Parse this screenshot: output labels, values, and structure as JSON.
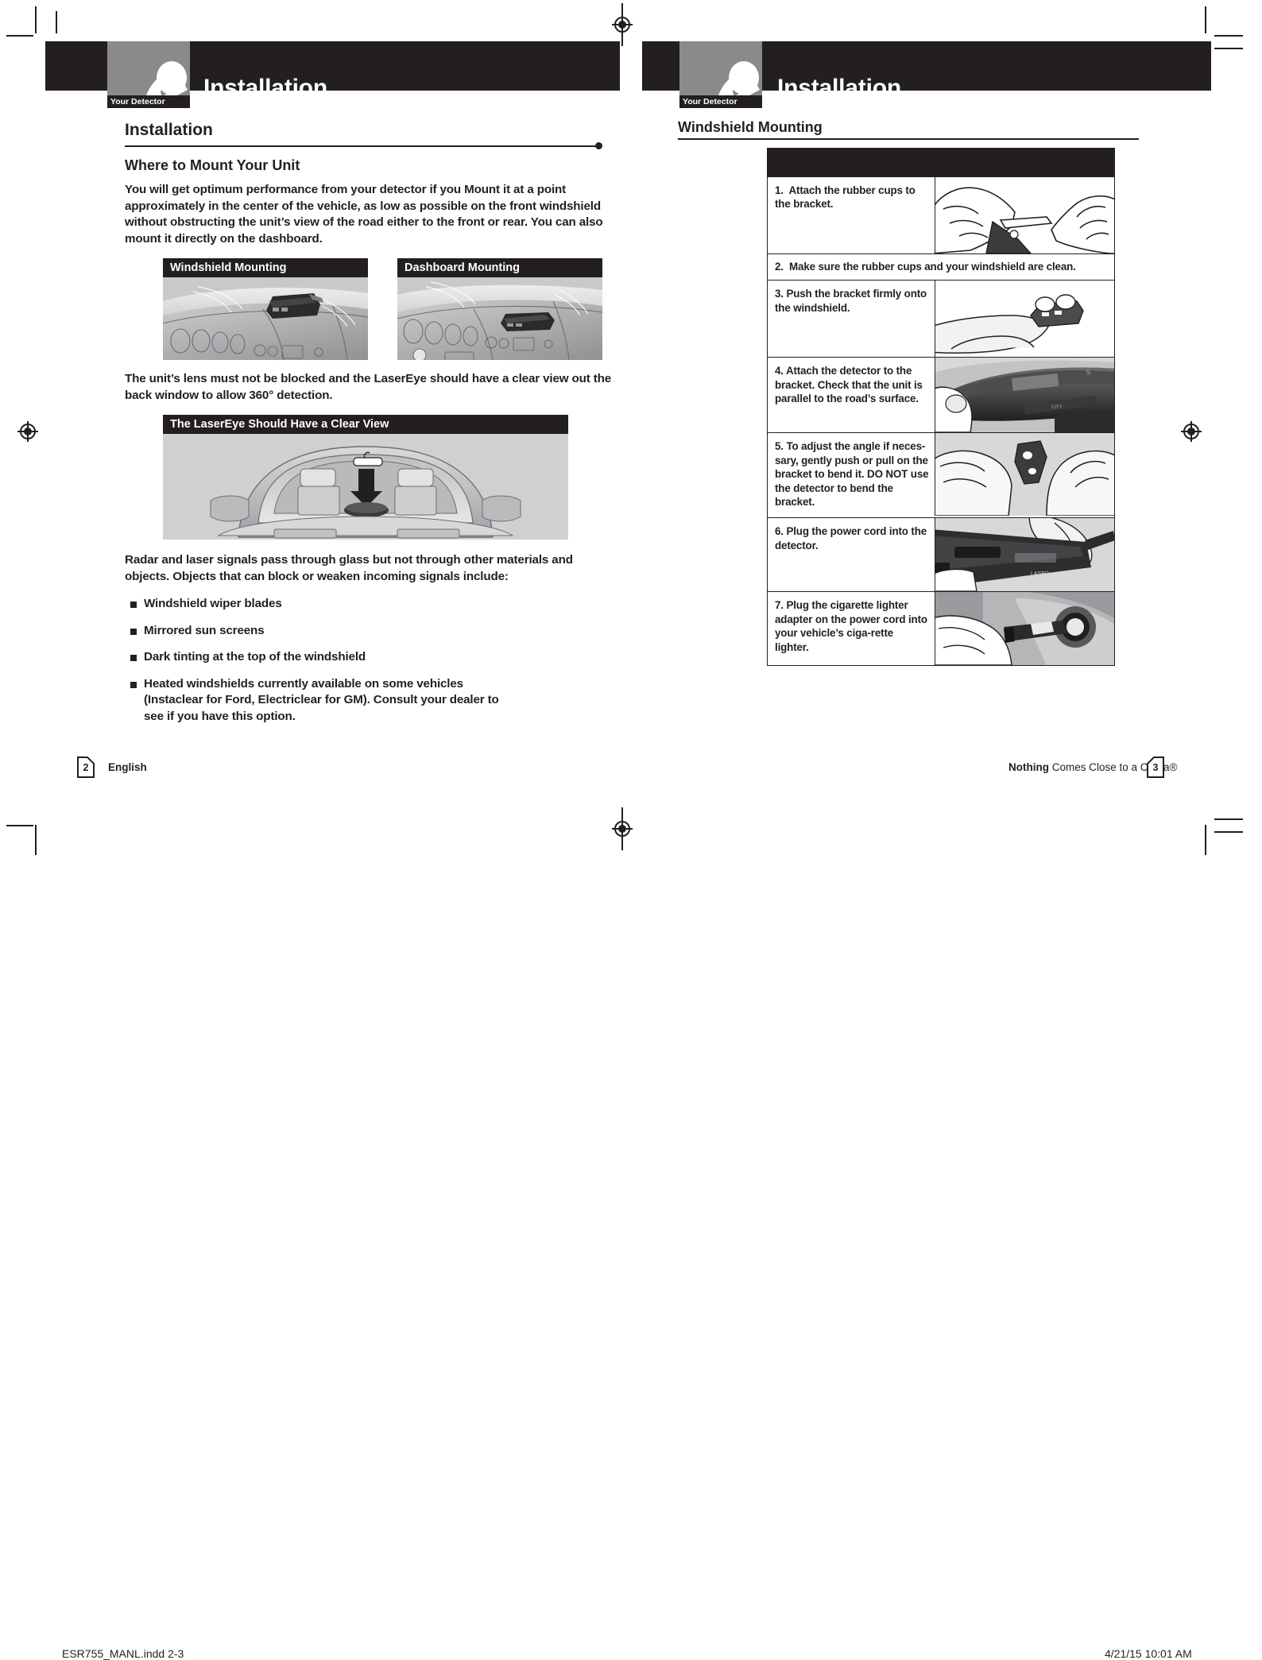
{
  "spread": {
    "left_page": {
      "banner": {
        "title": "Installation",
        "tab_label": "Your Detector",
        "tab_icon": "detector-icon"
      },
      "section_title": "Installation",
      "subsection_title": "Where to Mount Your Unit",
      "intro_paragraph_1": "You will get optimum performance from your detector if you ",
      "intro_bold": "Mount",
      "intro_paragraph_2": " it at a point approximately in the center of the vehicle, as low as possible on the front windshield without obstructing the unit’s view of the road either to the front or rear. You can also mount it directly on the dashboard.",
      "figure_row": [
        {
          "caption": "Windshield Mounting",
          "image": "windshield-mounting-illustration"
        },
        {
          "caption": "Dashboard Mounting",
          "image": "dashboard-mounting-illustration"
        }
      ],
      "paragraph_lens": "The unit’s lens must not be blocked and the LaserEye should have a clear view out the back window to allow 360° detection.",
      "figure_wide": {
        "caption": "The LaserEye Should Have a Clear View",
        "image": "rear-view-clear-view-illustration"
      },
      "paragraph_signals": "Radar and laser signals pass through glass but not through other materials and objects. Objects that can block or weaken incoming signals include:",
      "bullets": [
        "Windshield wiper blades",
        "Mirrored sun screens",
        "Dark tinting at the top of the windshield",
        "Heated windshields currently available on some vehicles (Instaclear for Ford, Electriclear for GM). Consult your dealer to see if you have this option."
      ],
      "footer": {
        "page_number": "2",
        "label": "English"
      }
    },
    "right_page": {
      "banner": {
        "title": "Installation",
        "tab_label": "Your Detector",
        "tab_icon": "detector-icon"
      },
      "section_title": "Windshield Mounting",
      "steps": [
        {
          "number": "1.",
          "text": "Attach the rubber cups to the bracket.",
          "bold_tail": "",
          "image": "attach-rubber-cups-illustration",
          "full_width": false
        },
        {
          "number": "2.",
          "text": "Make sure the rubber cups and your windshield are clean.",
          "bold_tail": "",
          "image": "",
          "full_width": true
        },
        {
          "number": "3.",
          "text": "Push the bracket firmly onto the windshield.",
          "bold_tail": "",
          "image": "push-bracket-illustration",
          "full_width": false
        },
        {
          "number": "4.",
          "text": "Attach the detector to ",
          "bold_tail": "the bracket. Check that the unit is parallel to the road’s surface.",
          "image": "attach-detector-illustration",
          "full_width": false
        },
        {
          "number": "5.",
          "text": "To adjust the angle if neces-sary, gently push or pull on the bracket to bend it. DO NOT use the detector to bend the bracket.",
          "bold_tail": "",
          "image": "bend-bracket-illustration",
          "full_width": false
        },
        {
          "number": "6.",
          "text": "Plug the power cord into the detector.",
          "bold_tail": "",
          "image": "plug-power-cord-illustration",
          "full_width": false
        },
        {
          "number": "7.",
          "text": "Plug the cigarette lighter adapter on the power cord into your vehicle’s ciga-rette lighter.",
          "bold_tail": "",
          "image": "cigarette-lighter-illustration",
          "full_width": false
        }
      ],
      "footer": {
        "tagline_bold": "Nothing",
        "tagline_rest": " Comes Close to a Cobra®",
        "page_number": "3"
      }
    }
  },
  "print_bar": {
    "file_name": "ESR755_MANL.indd   2-3",
    "timestamp": "4/21/15   10:01 AM"
  },
  "colors": {
    "ink": "#231f20",
    "tab_gray": "#8a8a8d",
    "figure_gray": "#cfd0d2",
    "paper": "#ffffff"
  }
}
